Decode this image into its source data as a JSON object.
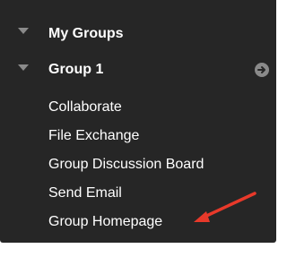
{
  "nav": {
    "my_groups": {
      "label": "My Groups",
      "toggle_icon": "triangle-down-icon"
    },
    "group1": {
      "label": "Group 1",
      "toggle_icon": "triangle-down-icon",
      "action_icon": "circle-arrow-right-icon",
      "items": [
        {
          "label": "Collaborate"
        },
        {
          "label": "File Exchange"
        },
        {
          "label": "Group Discussion Board"
        },
        {
          "label": "Send Email"
        },
        {
          "label": "Group Homepage"
        }
      ]
    }
  },
  "annotation": {
    "arrow_color": "#e8392a"
  },
  "colors": {
    "panel_bg": "#262626",
    "text": "#ffffff",
    "icon": "#8a8a8a"
  }
}
